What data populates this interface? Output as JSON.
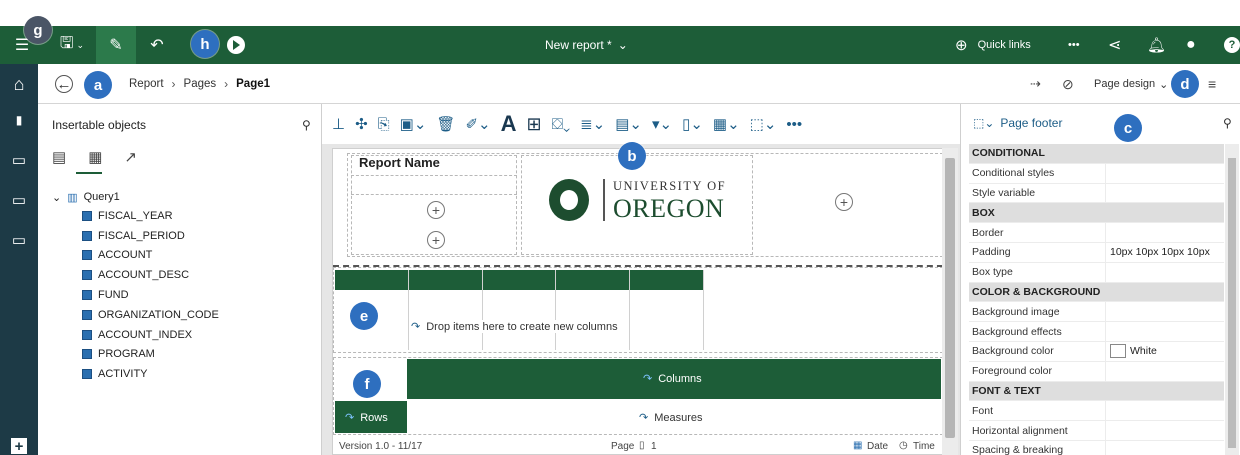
{
  "topbar": {
    "report_title": "New report *",
    "quick_links": "Quick links",
    "more": "•••",
    "help": "?"
  },
  "breadcrumb": {
    "items": [
      "Report",
      "Pages",
      "Page1"
    ],
    "page_design": "Page design"
  },
  "left_panel": {
    "title": "Insertable objects",
    "query": "Query1",
    "fields": [
      "FISCAL_YEAR",
      "FISCAL_PERIOD",
      "ACCOUNT",
      "ACCOUNT_DESC",
      "FUND",
      "ORGANIZATION_CODE",
      "ACCOUNT_INDEX",
      "PROGRAM",
      "ACTIVITY"
    ]
  },
  "canvas": {
    "report_name": "Report Name",
    "logo_line1": "UNIVERSITY OF",
    "logo_line2": "OREGON",
    "drop_text": "Drop items here to create new columns",
    "columns": "Columns",
    "rows": "Rows",
    "measures": "Measures",
    "footer_version": "Version 1.0 - 11/17",
    "footer_page": "Page",
    "footer_page_num": "1",
    "footer_date": "Date",
    "footer_time": "Time"
  },
  "right_panel": {
    "title": "Page footer",
    "rows": [
      {
        "k": "CONDITIONAL",
        "v": "",
        "sec": true
      },
      {
        "k": "Conditional styles",
        "v": ""
      },
      {
        "k": "Style variable",
        "v": ""
      },
      {
        "k": "BOX",
        "v": "",
        "sec": true
      },
      {
        "k": "Border",
        "v": ""
      },
      {
        "k": "Padding",
        "v": "10px 10px 10px 10px"
      },
      {
        "k": "Box type",
        "v": ""
      },
      {
        "k": "COLOR & BACKGROUND",
        "v": "",
        "sec": true
      },
      {
        "k": "Background image",
        "v": ""
      },
      {
        "k": "Background effects",
        "v": ""
      },
      {
        "k": "Background color",
        "v": "White"
      },
      {
        "k": "Foreground color",
        "v": ""
      },
      {
        "k": "FONT & TEXT",
        "v": "",
        "sec": true
      },
      {
        "k": "Font",
        "v": ""
      },
      {
        "k": "Horizontal alignment",
        "v": ""
      },
      {
        "k": "Spacing & breaking",
        "v": ""
      }
    ]
  },
  "markers": {
    "a": "a",
    "b": "b",
    "c": "c",
    "d": "d",
    "e": "e",
    "f": "f",
    "g": "g",
    "h": "h"
  },
  "colors": {
    "brand_green": "#1d5d38",
    "rail": "#1d3a46",
    "marker": "#2e6fbf"
  }
}
